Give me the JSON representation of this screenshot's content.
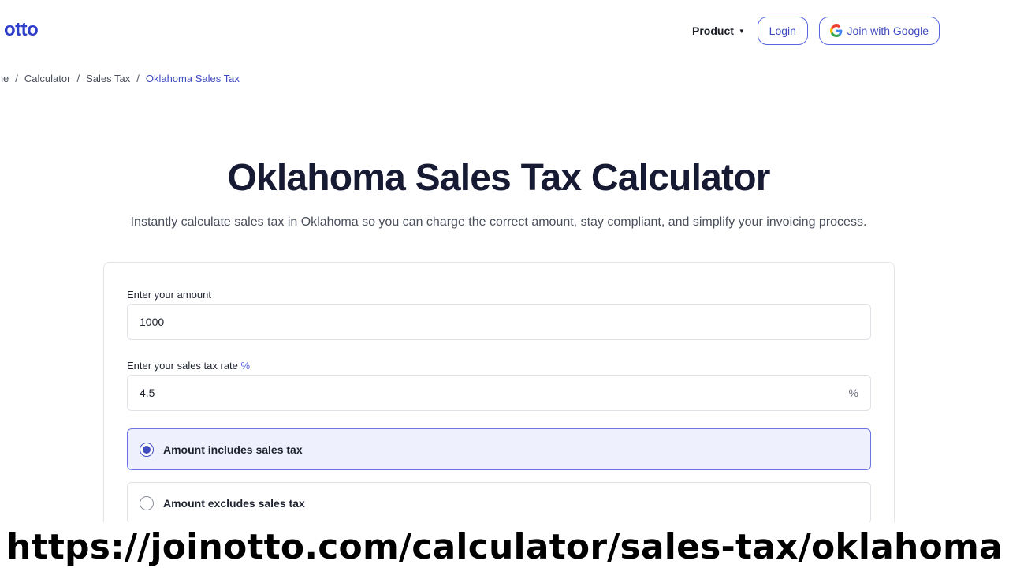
{
  "header": {
    "logo": "otto",
    "nav": {
      "product_label": "Product",
      "login_label": "Login",
      "google_label": "Join with Google"
    }
  },
  "breadcrumb": {
    "items": [
      "ome",
      "Calculator",
      "Sales Tax"
    ],
    "current": "Oklahoma Sales Tax",
    "separator": "/"
  },
  "hero": {
    "title": "Oklahoma Sales Tax Calculator",
    "subtitle": "Instantly calculate sales tax in Oklahoma so you can charge the correct amount, stay compliant, and simplify your invoicing process."
  },
  "form": {
    "amount": {
      "label": "Enter your amount",
      "value": "1000"
    },
    "rate": {
      "label": "Enter your sales tax rate",
      "label_suffix": "%",
      "value": "4.5",
      "suffix": "%"
    },
    "options": [
      {
        "label": "Amount includes sales tax",
        "selected": true
      },
      {
        "label": "Amount excludes sales tax",
        "selected": false
      }
    ]
  },
  "caption": "https://joinotto.com/calculator/sales-tax/oklahoma",
  "colors": {
    "brand": "#2f3fc9",
    "accent": "#3f4bbf",
    "selected_bg": "#eef0fd"
  }
}
